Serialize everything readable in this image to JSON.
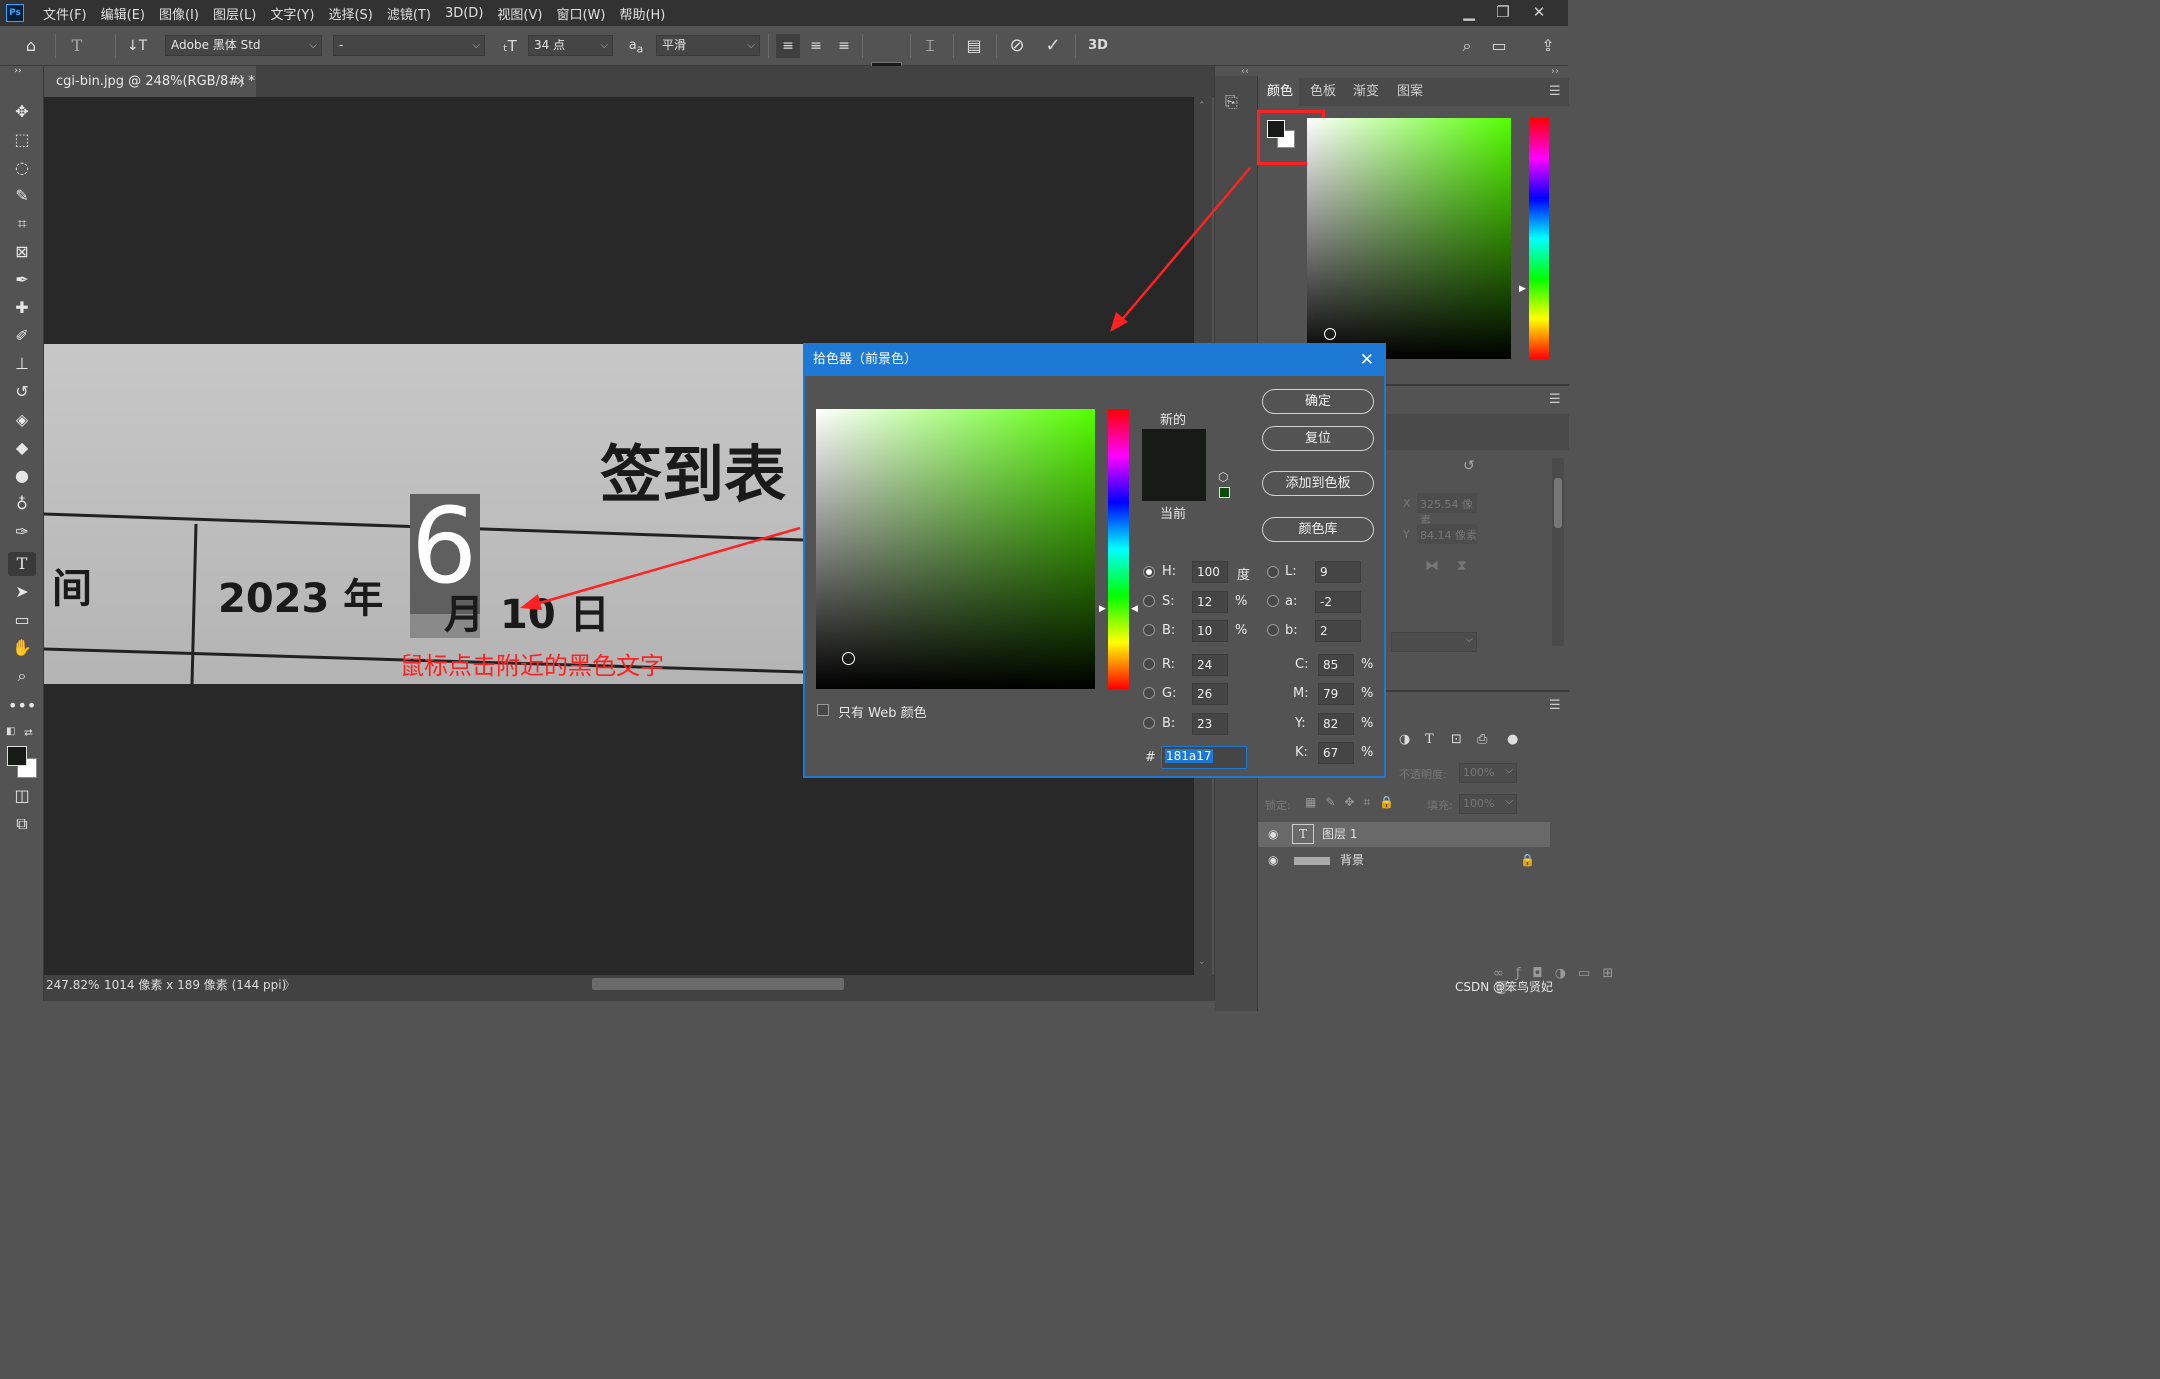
{
  "menubar": {
    "logo": "Ps",
    "items": [
      "文件(F)",
      "编辑(E)",
      "图像(I)",
      "图层(L)",
      "文字(Y)",
      "选择(S)",
      "滤镜(T)",
      "3D(D)",
      "视图(V)",
      "窗口(W)",
      "帮助(H)"
    ]
  },
  "options": {
    "font_family": "Adobe 黑体 Std",
    "font_style": "-",
    "font_size": "34 点",
    "antialias_prefix": "a",
    "antialias_suffix": "a",
    "antialias": "平滑",
    "threed": "3D"
  },
  "document": {
    "tab_title": "cgi-bin.jpg @ 248%(RGB/8#) *",
    "close": "×",
    "zoom": "247.82%",
    "dimensions": "1014 像素 x 189 像素 (144 ppi)",
    "status_arrow": "〉",
    "paper_title": "签到表",
    "paper_left_cell": "间",
    "paper_year": "2023 年",
    "paper_month_partial": "月",
    "paper_day": "10 日",
    "typed_char": "6",
    "annotation": "鼠标点击附近的黑色文字"
  },
  "right_panel": {
    "collapse_left": "‹‹",
    "collapse_right": "››",
    "tabs": [
      "颜色",
      "色板",
      "渐变",
      "图案"
    ],
    "active_tab": "颜色",
    "props_x_label": "X",
    "props_x": "325.54 像素",
    "props_y_label": "Y",
    "props_y": "84.14 像素",
    "opacity_label": "不透明度:",
    "opacity": "100%",
    "lock_label": "锁定:",
    "fill_label": "填充:",
    "fill": "100%",
    "layers": [
      {
        "name": "图层 1",
        "type": "text",
        "selected": true
      },
      {
        "name": "背景",
        "type": "image",
        "locked": true
      }
    ],
    "watermark": "CSDN @笨鸟贤妃"
  },
  "dialog": {
    "title": "拾色器（前景色）",
    "new_label": "新的",
    "current_label": "当前",
    "buttons": {
      "ok": "确定",
      "reset": "复位",
      "add_swatch": "添加到色板",
      "libraries": "颜色库"
    },
    "web_only": "只有 Web 颜色",
    "fields": {
      "H": {
        "label": "H:",
        "value": "100",
        "unit": "度"
      },
      "S": {
        "label": "S:",
        "value": "12",
        "unit": "%"
      },
      "B": {
        "label": "B:",
        "value": "10",
        "unit": "%"
      },
      "R": {
        "label": "R:",
        "value": "24"
      },
      "G": {
        "label": "G:",
        "value": "26"
      },
      "B2": {
        "label": "B:",
        "value": "23"
      },
      "L": {
        "label": "L:",
        "value": "9"
      },
      "a": {
        "label": "a:",
        "value": "-2"
      },
      "b": {
        "label": "b:",
        "value": "2"
      },
      "C": {
        "label": "C:",
        "value": "85",
        "unit": "%"
      },
      "M": {
        "label": "M:",
        "value": "79",
        "unit": "%"
      },
      "Y": {
        "label": "Y:",
        "value": "82",
        "unit": "%"
      },
      "K": {
        "label": "K:",
        "value": "67",
        "unit": "%"
      }
    },
    "hex_label": "#",
    "hex": "181a17",
    "selected_mode": "H",
    "colors": {
      "new": "#181a17",
      "current": "#181a17",
      "hue_accent": "#55ff00"
    }
  }
}
